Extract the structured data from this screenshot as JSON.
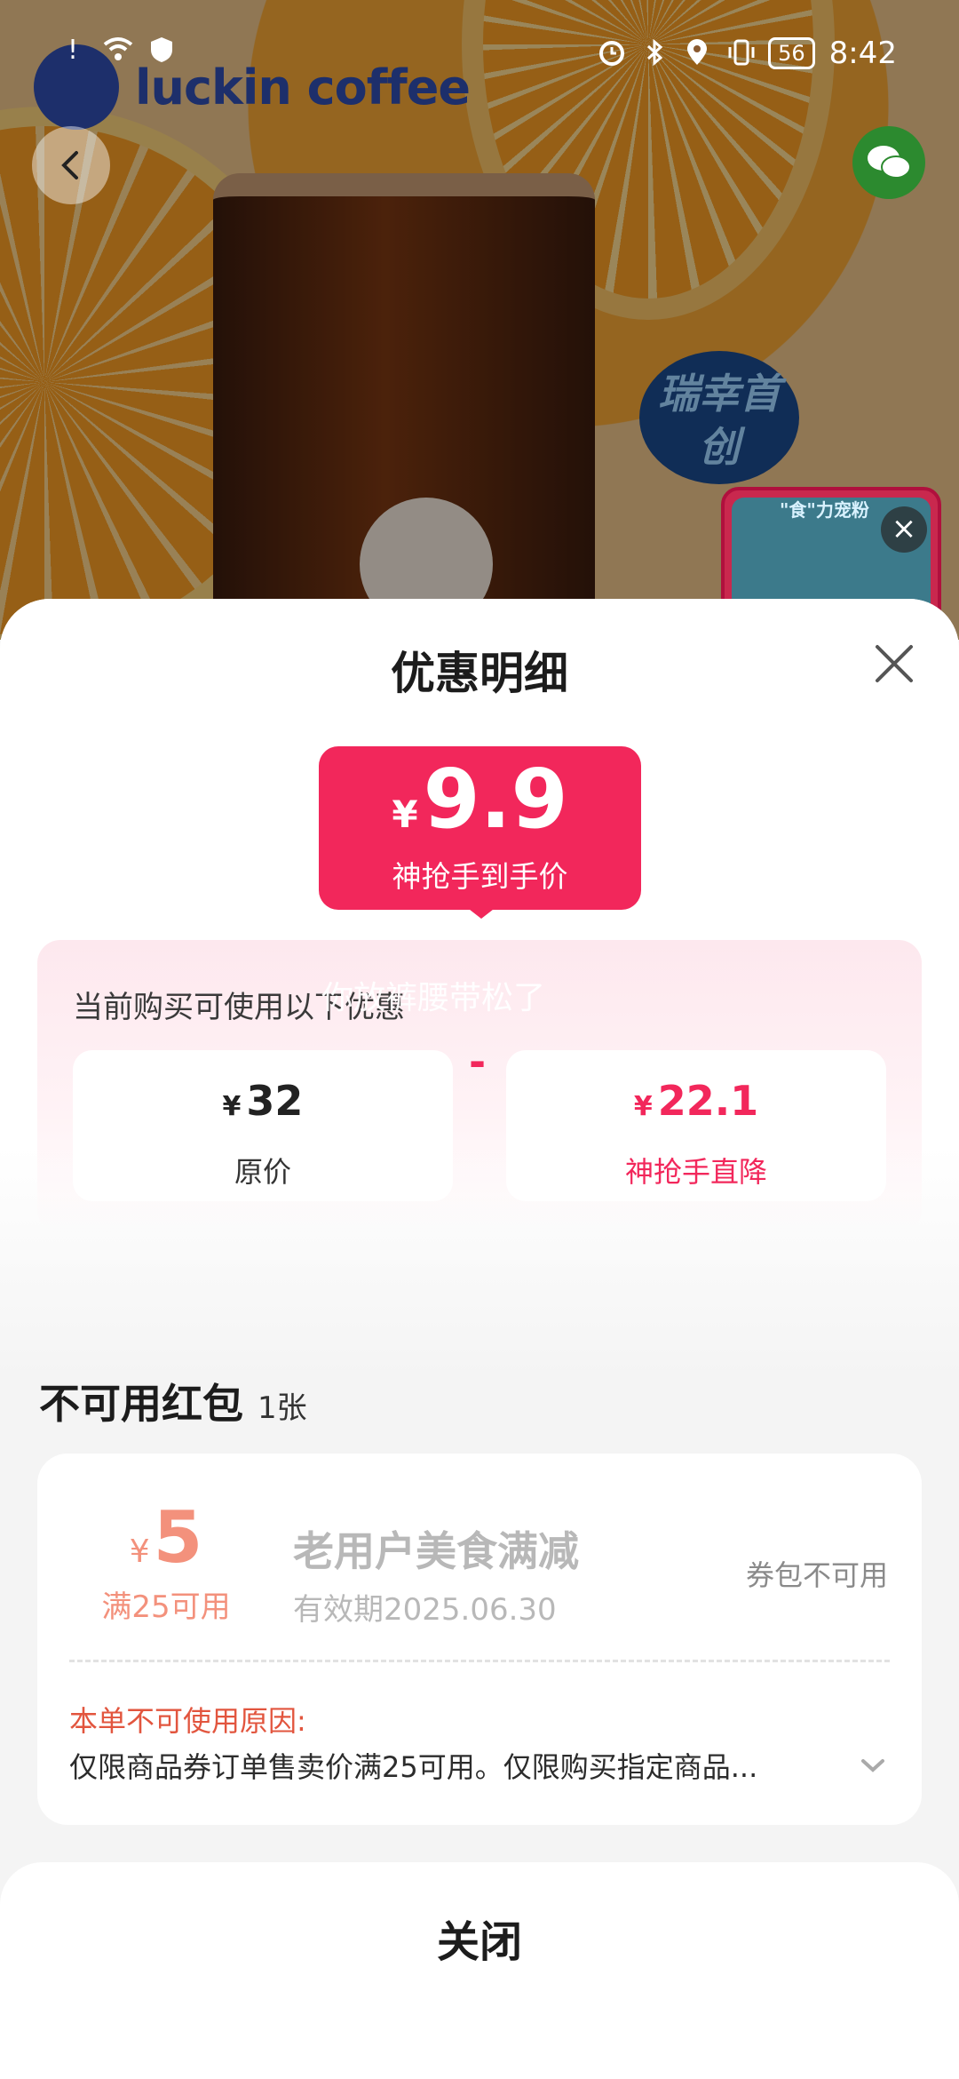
{
  "status_bar": {
    "time": "8:42",
    "battery": "56",
    "left_icons": [
      "alert-icon",
      "wifi-icon",
      "shield-icon"
    ],
    "right_icons": [
      "alarm-icon",
      "bluetooth-icon",
      "location-icon",
      "vibrate-icon"
    ]
  },
  "hero": {
    "brand": "luckin coffee",
    "badge": "瑞幸首创",
    "promo_card_title": "\"食\"力宠粉"
  },
  "sheet": {
    "title": "优惠明细",
    "price": {
      "currency": "¥",
      "amount": "9.9",
      "label": "神抢手到手价"
    },
    "discount_hint": "当前购买可使用以下优惠",
    "watermark": "你放裤腰带松了",
    "original": {
      "currency": "¥",
      "amount": "32",
      "label": "原价"
    },
    "operator": "-",
    "reduction": {
      "currency": "¥",
      "amount": "22.1",
      "label": "神抢手直降"
    },
    "unavailable": {
      "title": "不可用红包",
      "count": "1张",
      "coupon": {
        "currency": "¥",
        "amount": "5",
        "condition": "满25可用",
        "name": "老用户美食满减",
        "validity": "有效期2025.06.30",
        "status": "券包不可用",
        "reason_title": "本单不可使用原因:",
        "reason": "仅限商品券订单售卖价满25可用。仅限购买指定商品..."
      }
    },
    "close_label": "关闭"
  },
  "colors": {
    "accent": "#f2275b",
    "coupon_amount": "#f3917c",
    "reason_title": "#e2553e"
  }
}
